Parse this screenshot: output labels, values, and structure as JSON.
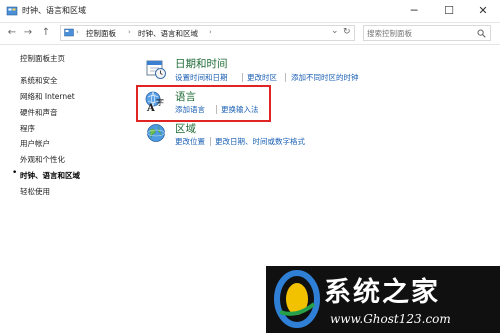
{
  "window": {
    "title": "时钟、语言和区域",
    "minimize_glyph": "─",
    "maximize_glyph": "☐",
    "close_glyph": "✕"
  },
  "address_bar": {
    "back_glyph": "←",
    "forward_glyph": "→",
    "up_glyph": "↑",
    "breadcrumbs": [
      "控制面板",
      "时钟、语言和区域"
    ],
    "separator": "›",
    "dropdown_glyph": "⌄",
    "refresh_glyph": "↻",
    "search_placeholder": "搜索控制面板"
  },
  "sidebar": {
    "items": [
      {
        "label": "控制面板主页"
      },
      {
        "label": "系统和安全"
      },
      {
        "label": "网络和 Internet"
      },
      {
        "label": "硬件和声音"
      },
      {
        "label": "程序"
      },
      {
        "label": "用户帐户"
      },
      {
        "label": "外观和个性化"
      },
      {
        "label": "时钟、语言和区域",
        "current": true
      },
      {
        "label": "轻松使用"
      }
    ],
    "current_bullet": "•"
  },
  "sections": {
    "datetime": {
      "title": "日期和时间",
      "links": [
        "设置时间和日期",
        "更改时区",
        "添加不同时区的时钟"
      ]
    },
    "language": {
      "title": "语言",
      "links": [
        "添加语言",
        "更换输入法"
      ]
    },
    "region": {
      "title": "区域",
      "links": [
        "更改位置",
        "更改日期、时间或数字格式"
      ]
    }
  },
  "watermark": {
    "text": "系统之家",
    "url": "www.Ghost123.com"
  },
  "colors": {
    "highlight_border": "#e02424",
    "link": "#1a5fb4",
    "section_title": "#1e6b35"
  }
}
